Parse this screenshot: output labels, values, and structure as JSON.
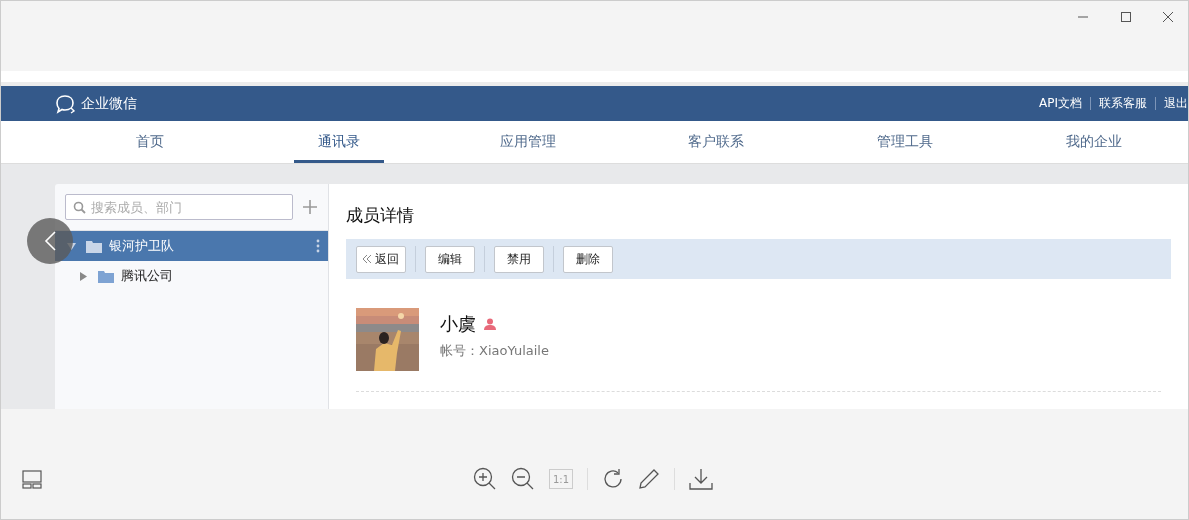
{
  "header": {
    "brand": "企业微信",
    "links": [
      "API文档",
      "联系客服",
      "退出"
    ]
  },
  "nav": [
    {
      "label": "首页",
      "selected": false
    },
    {
      "label": "通讯录",
      "selected": true
    },
    {
      "label": "应用管理",
      "selected": false
    },
    {
      "label": "客户联系",
      "selected": false
    },
    {
      "label": "管理工具",
      "selected": false
    },
    {
      "label": "我的企业",
      "selected": false
    }
  ],
  "search": {
    "placeholder": "搜索成员、部门"
  },
  "tree": [
    {
      "label": "银河护卫队",
      "selected": true,
      "expanded": true,
      "children": [
        {
          "label": "腾讯公司",
          "selected": false,
          "expanded": false
        }
      ]
    }
  ],
  "detail": {
    "title": "成员详情",
    "buttons": [
      {
        "label": "返回",
        "kind": "back"
      },
      {
        "label": "编辑",
        "kind": "plain"
      },
      {
        "label": "禁用",
        "kind": "plain"
      },
      {
        "label": "删除",
        "kind": "plain"
      }
    ],
    "member": {
      "name": "小虞",
      "account_label": "帐号：",
      "account": "XiaoYulaile"
    }
  },
  "viewer": {
    "actual_size": {
      "label": "1:1",
      "disabled": true
    }
  }
}
